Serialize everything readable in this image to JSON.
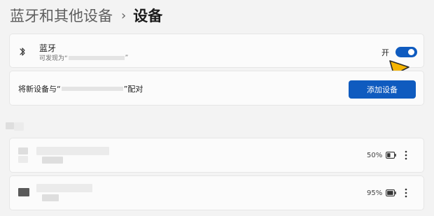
{
  "breadcrumb": {
    "parent": "蓝牙和其他设备",
    "current": "设备"
  },
  "bluetooth": {
    "title": "蓝牙",
    "discoverable_prefix": "可发现为“",
    "discoverable_suffix": "”",
    "toggle_label": "开",
    "toggle_on": true,
    "icon": "bluetooth-icon"
  },
  "pair": {
    "text_prefix": "将新设备与“",
    "text_suffix": "”配对",
    "button_label": "添加设备"
  },
  "devices": [
    {
      "battery": "50%",
      "battery_level": 0.5,
      "icon": "battery-icon"
    },
    {
      "battery": "95%",
      "battery_level": 0.95,
      "icon": "battery-icon"
    }
  ],
  "colors": {
    "accent": "#0f5bbf",
    "background": "#f3f3f3",
    "card": "#fbfbfb",
    "cursor": "#f5b400"
  }
}
